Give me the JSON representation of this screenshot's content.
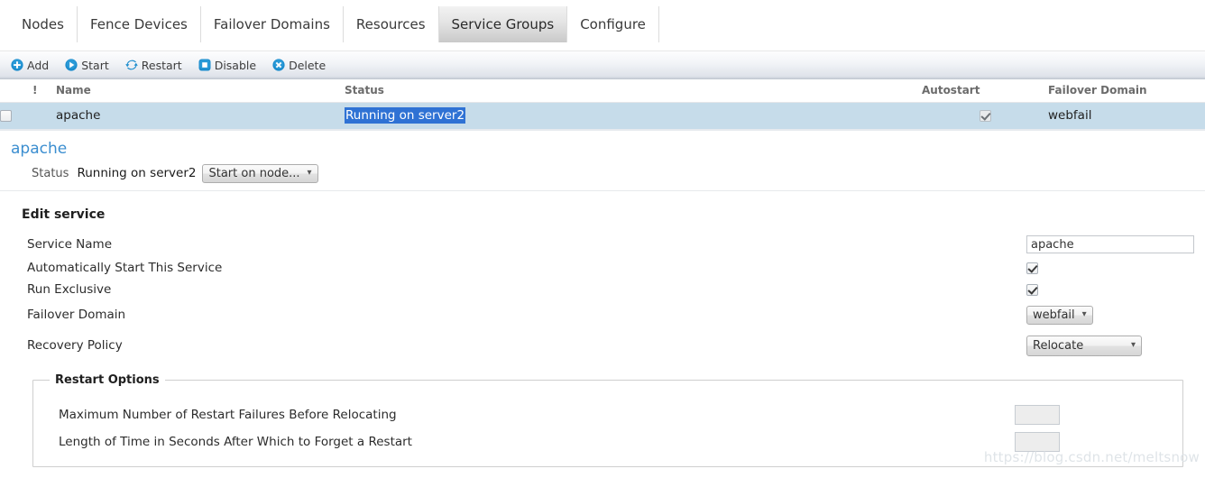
{
  "tabs": [
    {
      "label": "Nodes",
      "active": false
    },
    {
      "label": "Fence Devices",
      "active": false
    },
    {
      "label": "Failover Domains",
      "active": false
    },
    {
      "label": "Resources",
      "active": false
    },
    {
      "label": "Service Groups",
      "active": true
    },
    {
      "label": "Configure",
      "active": false
    }
  ],
  "toolbar": {
    "add_label": "Add",
    "start_label": "Start",
    "restart_label": "Restart",
    "disable_label": "Disable",
    "delete_label": "Delete",
    "icons": {
      "add": "plus-circle-icon",
      "start": "play-circle-icon",
      "restart": "restart-arrows-icon",
      "disable": "stop-square-icon",
      "delete": "x-circle-icon"
    },
    "accent_color": "#1b8ccd"
  },
  "table": {
    "headers": {
      "bang": "!",
      "name": "Name",
      "status": "Status",
      "autostart": "Autostart",
      "failover_domain": "Failover Domain"
    },
    "rows": [
      {
        "checked": false,
        "bang": "",
        "name": "apache",
        "status": "Running on server2",
        "status_selected": true,
        "autostart_checked": true,
        "failover_domain": "webfail"
      }
    ],
    "selection_highlight_color": "#2f72d4",
    "row_highlight_color": "#c6dcea"
  },
  "detail": {
    "service_title": "apache",
    "status_label": "Status",
    "status_value": "Running on server2",
    "node_select_value": "Start on node...",
    "title_color": "#3b8ed0"
  },
  "edit": {
    "section_title": "Edit service",
    "fields": {
      "service_name_label": "Service Name",
      "service_name_value": "apache",
      "autostart_label": "Automatically Start This Service",
      "autostart_checked": true,
      "exclusive_label": "Run Exclusive",
      "exclusive_checked": true,
      "failover_domain_label": "Failover Domain",
      "failover_domain_value": "webfail",
      "recovery_policy_label": "Recovery Policy",
      "recovery_policy_value": "Relocate"
    }
  },
  "restart_options": {
    "legend": "Restart Options",
    "max_failures_label": "Maximum Number of Restart Failures Before Relocating",
    "max_failures_value": "",
    "forget_time_label": "Length of Time in Seconds After Which to Forget a Restart",
    "forget_time_value": ""
  },
  "watermark": "https://blog.csdn.net/meltsnow"
}
